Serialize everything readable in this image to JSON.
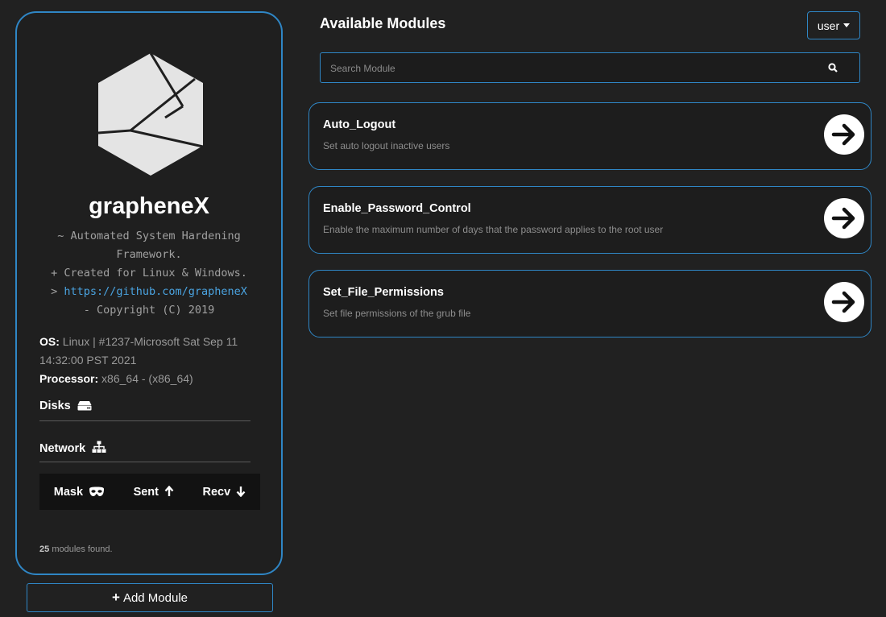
{
  "sidebar": {
    "app_name": "grapheneX",
    "tagline": {
      "line1": "~ Automated System Hardening",
      "line2": "Framework.",
      "line3": "+ Created for Linux & Windows.",
      "line4_prefix": ">",
      "link": "https://github.com/grapheneX",
      "line5": "- Copyright (C) 2019"
    },
    "os_label": "OS:",
    "os_value": "Linux | #1237-Microsoft Sat Sep 11 14:32:00 PST 2021",
    "processor_label": "Processor:",
    "processor_value": "x86_64 - (x86_64)",
    "disks_label": "Disks",
    "network_label": "Network",
    "network_columns": [
      "Mask",
      "Sent",
      "Recv"
    ],
    "modules_count": "25",
    "modules_found_text": "modules found.",
    "add_module_label": "Add Module"
  },
  "header": {
    "title": "Available Modules",
    "user_label": "user"
  },
  "search": {
    "placeholder": "Search Module",
    "value": ""
  },
  "modules": [
    {
      "name": "Auto_Logout",
      "description": "Set auto logout inactive users"
    },
    {
      "name": "Enable_Password_Control",
      "description": "Enable the maximum number of days that the password applies to the root user"
    },
    {
      "name": "Set_File_Permissions",
      "description": "Set file permissions of the grub file"
    }
  ],
  "icons": {
    "logo": "hexagon-logo-icon",
    "disks": "hdd-icon",
    "network": "network-icon",
    "mask": "mask-icon",
    "sent": "arrow-up-icon",
    "recv": "arrow-down-icon",
    "search": "search-icon",
    "module_go": "arrow-right-circle-icon",
    "add": "plus-icon"
  },
  "colors": {
    "background": "#212121",
    "accent": "#2f86c5",
    "link": "#4aa3e0"
  }
}
